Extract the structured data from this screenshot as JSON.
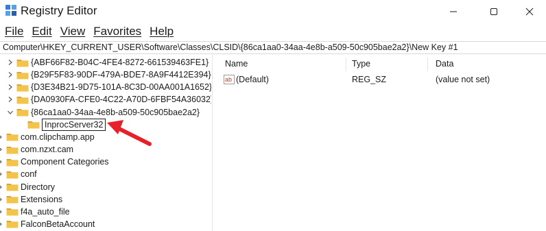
{
  "window": {
    "title": "Registry Editor",
    "minimize_icon": "minimize-icon",
    "maximize_icon": "maximize-icon",
    "close_icon": "close-icon"
  },
  "menu": {
    "file": "File",
    "edit": "Edit",
    "view": "View",
    "favorites": "Favorites",
    "help": "Help"
  },
  "address": "Computer\\HKEY_CURRENT_USER\\Software\\Classes\\CLSID\\{86ca1aa0-34aa-4e8b-a509-50c905bae2a2}\\New Key #1",
  "tree": {
    "items": [
      {
        "label": "{ABF66F82-B04C-4FE4-8272-661539463FE1}",
        "expand": "collapsed"
      },
      {
        "label": "{B29F5F83-90DF-479A-BDE7-8A9F4412E394}",
        "expand": "collapsed"
      },
      {
        "label": "{D3E34B21-9D75-101A-8C3D-00AA001A1652}",
        "expand": "collapsed"
      },
      {
        "label": "{DA0930FA-CFE0-4C22-A70D-6FBF54A36032}",
        "expand": "collapsed"
      },
      {
        "label": "{86ca1aa0-34aa-4e8b-a509-50c905bae2a2}",
        "expand": "expanded"
      },
      {
        "label": "InprocServer32",
        "expand": "none",
        "editing": true
      },
      {
        "label": "com.clipchamp.app",
        "expand": "collapsed"
      },
      {
        "label": "com.nzxt.cam",
        "expand": "collapsed"
      },
      {
        "label": "Component Categories",
        "expand": "collapsed"
      },
      {
        "label": "conf",
        "expand": "collapsed"
      },
      {
        "label": "Directory",
        "expand": "collapsed"
      },
      {
        "label": "Extensions",
        "expand": "collapsed"
      },
      {
        "label": "f4a_auto_file",
        "expand": "collapsed"
      },
      {
        "label": "FalconBetaAccount",
        "expand": "collapsed"
      }
    ]
  },
  "values": {
    "headers": {
      "name": "Name",
      "type": "Type",
      "data": "Data"
    },
    "rows": [
      {
        "name": "(Default)",
        "type": "REG_SZ",
        "data": "(value not set)",
        "icon": "reg-string-icon",
        "icon_text": "ab"
      }
    ]
  },
  "colors": {
    "folder": "#f2c44b",
    "folder_dark": "#dca533",
    "arrow": "#e8202a"
  }
}
